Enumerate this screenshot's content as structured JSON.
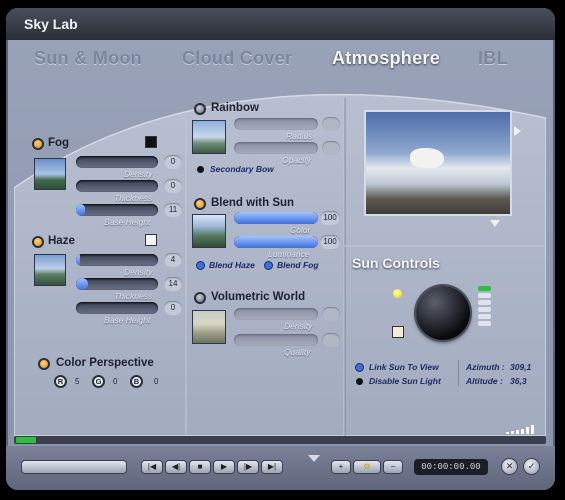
{
  "window": {
    "title": "Sky Lab"
  },
  "tabs": [
    {
      "label": "Sun & Moon",
      "active": false
    },
    {
      "label": "Cloud Cover",
      "active": false
    },
    {
      "label": "Atmosphere",
      "active": true
    },
    {
      "label": "IBL",
      "active": false
    }
  ],
  "fog": {
    "label": "Fog",
    "swatch_color": "#111111",
    "density": {
      "label": "Density",
      "value": "0",
      "level": 0
    },
    "thickness": {
      "label": "Thickness",
      "value": "0",
      "level": 0
    },
    "base_height": {
      "label": "Base Height",
      "value": "11",
      "level": 0.11
    }
  },
  "haze": {
    "label": "Haze",
    "swatch_color": "#f4f4f4",
    "density": {
      "label": "Density",
      "value": "4",
      "level": 0.04
    },
    "thickness": {
      "label": "Thickness",
      "value": "14",
      "level": 0.14
    },
    "base_height": {
      "label": "Base Height",
      "value": "0",
      "level": 0
    }
  },
  "color_perspective": {
    "label": "Color Perspective",
    "r_label": "R",
    "r_value": "5",
    "g_label": "G",
    "g_value": "0",
    "b_label": "B",
    "b_value": "0"
  },
  "rainbow": {
    "label": "Rainbow",
    "radius_label": "Radius",
    "opacity_label": "Opacity",
    "secondary_bow": "Secondary Bow"
  },
  "blend_with_sun": {
    "label": "Blend with Sun",
    "color": {
      "label": "Color",
      "value": "100",
      "level": 1.0
    },
    "luminance": {
      "label": "Luminance",
      "value": "100",
      "level": 1.0
    },
    "blend_haze": "Blend Haze",
    "blend_fog": "Blend Fog"
  },
  "volumetric_world": {
    "label": "Volumetric World",
    "density_label": "Density",
    "quality_label": "Quality"
  },
  "sun_controls": {
    "title": "Sun Controls",
    "link_sun": "Link Sun To View",
    "disable_sun_light": "Disable Sun Light",
    "azimuth_label": "Azimuth :",
    "azimuth_value": "309,1",
    "altitude_label": "Altitude :",
    "altitude_value": "36,3"
  },
  "playback": {
    "time": "00:00:00.00"
  },
  "colors": {
    "accent_blue": "#3d6fe0",
    "radio_orange": "#e08a1a",
    "panel": "#9aa3b8"
  }
}
